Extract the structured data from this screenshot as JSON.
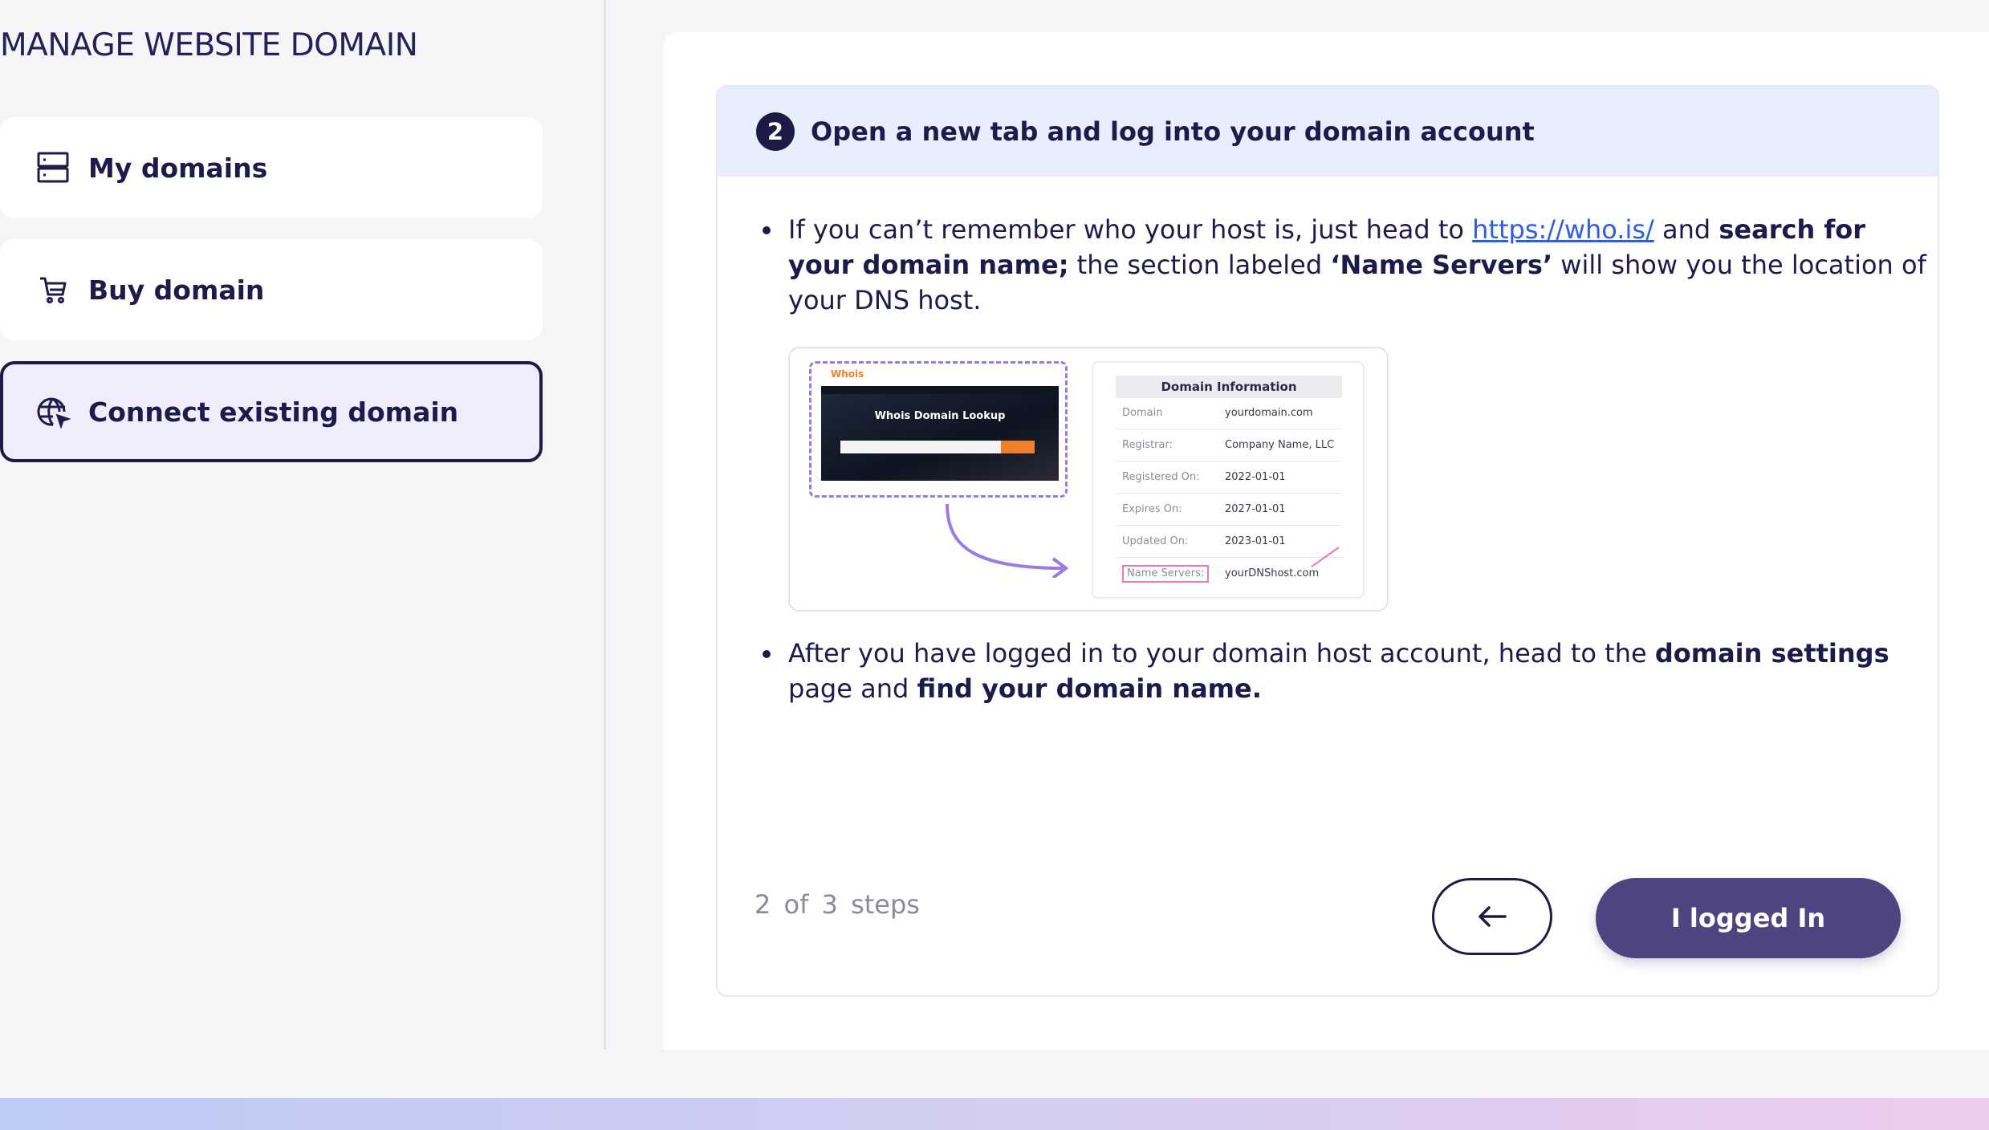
{
  "sidebar": {
    "title": "MANAGE WEBSITE DOMAIN",
    "items": [
      {
        "label": "My domains",
        "icon": "server-icon",
        "active": false
      },
      {
        "label": "Buy domain",
        "icon": "cart-icon",
        "active": false
      },
      {
        "label": "Connect existing domain",
        "icon": "globe-cursor-icon",
        "active": true
      }
    ]
  },
  "step": {
    "number": "2",
    "title": "Open a new tab and log into your domain account",
    "bullet1": {
      "t1": "If you can’t remember who your host is, just head to ",
      "link": "https://who.is/",
      "t2": " and ",
      "b1": "search for your domain name;",
      "t3": " the section labeled ",
      "b2": "‘Name Servers’",
      "t4": " will show you the location of your DNS host."
    },
    "bullet2": {
      "t1": "After you have logged in to your domain host account, head to the ",
      "b1": "domain settings",
      "t2": " page and ",
      "b2": "find your domain name."
    },
    "illustration": {
      "whois_logo": "Whois",
      "whois_title": "Whois Domain Lookup",
      "info_title": "Domain Information",
      "rows": [
        {
          "key": "Domain",
          "value": "yourdomain.com"
        },
        {
          "key": "Registrar:",
          "value": "Company Name, LLC"
        },
        {
          "key": "Registered On:",
          "value": "2022-01-01"
        },
        {
          "key": "Expires On:",
          "value": "2027-01-01"
        },
        {
          "key": "Updated On:",
          "value": "2023-01-01"
        },
        {
          "key": "Name Servers:",
          "value": "yourDNShost.com"
        }
      ]
    }
  },
  "footer": {
    "progress": "2 of 3 steps",
    "back_icon": "arrow-left-icon",
    "primary_label": "I logged In"
  },
  "colors": {
    "accent": "#4d457f",
    "navy": "#1d1b46",
    "header_bg": "#e8eefe",
    "active_bg": "#f1ecfb",
    "link": "#2b5fe0"
  }
}
